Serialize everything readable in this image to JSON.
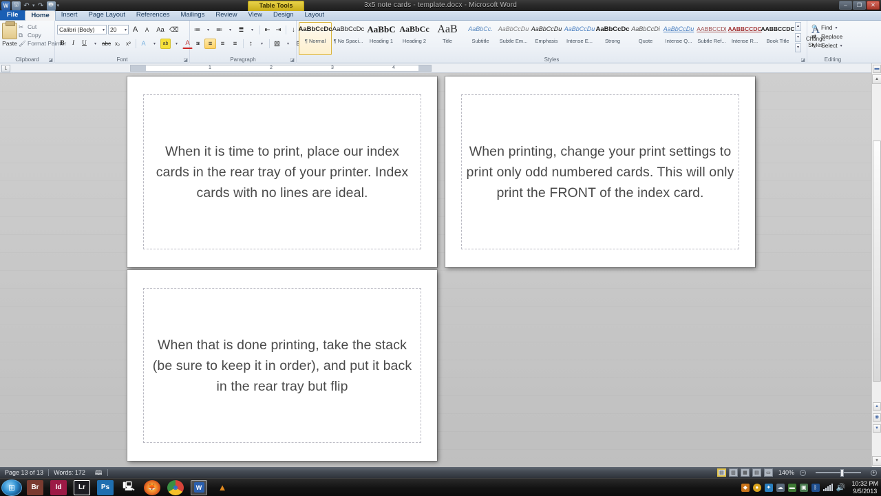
{
  "window": {
    "title": "3x5 note cards - template.docx - Microsoft Word",
    "contextual_tab": "Table Tools",
    "minimize": "–",
    "restore": "❐",
    "close": "✕"
  },
  "quick_access": {
    "app_icon": "word-icon",
    "app_letter": "W",
    "items": [
      {
        "name": "save-icon",
        "glyph": "🖫"
      },
      {
        "name": "undo-icon",
        "glyph": "↶"
      },
      {
        "name": "undo-dropdown-icon",
        "glyph": "▾"
      },
      {
        "name": "redo-icon",
        "glyph": "↷"
      },
      {
        "name": "print-preview-icon",
        "glyph": "🖶"
      },
      {
        "name": "customize-qat-icon",
        "glyph": "▾"
      }
    ]
  },
  "tabs": [
    {
      "label": "File",
      "state": "file"
    },
    {
      "label": "Home",
      "state": "active"
    },
    {
      "label": "Insert",
      "state": "normal"
    },
    {
      "label": "Page Layout",
      "state": "normal"
    },
    {
      "label": "References",
      "state": "normal"
    },
    {
      "label": "Mailings",
      "state": "normal"
    },
    {
      "label": "Review",
      "state": "normal"
    },
    {
      "label": "View",
      "state": "normal"
    },
    {
      "label": "Design",
      "state": "normal"
    },
    {
      "label": "Layout",
      "state": "normal"
    }
  ],
  "ribbon": {
    "clipboard": {
      "group_label": "Clipboard",
      "paste_label": "Paste",
      "cut_label": "Cut",
      "copy_label": "Copy",
      "format_painter_label": "Format Painter"
    },
    "font": {
      "group_label": "Font",
      "font_name": "Calibri (Body)",
      "font_size": "20",
      "grow_font": "A",
      "shrink_font": "A",
      "change_case": "Aa",
      "clear_formatting": "⌫",
      "bold": "B",
      "italic": "I",
      "underline": "U",
      "strikethrough": "abc",
      "subscript": "x₂",
      "superscript": "x²",
      "text_effects": "A",
      "highlight": "ab",
      "font_color": "A"
    },
    "paragraph": {
      "group_label": "Paragraph",
      "bullets": "≔",
      "numbering": "≕",
      "multilevel": "≣",
      "decrease_indent": "⇤",
      "increase_indent": "⇥",
      "sort": "↓",
      "show_marks": "¶",
      "align_left": "≡",
      "align_center": "≡",
      "align_right": "≡",
      "justify": "≡",
      "line_spacing": "↕",
      "shading": "▧",
      "borders": "⊞",
      "active_alignment": "align-center"
    },
    "styles": {
      "group_label": "Styles",
      "items": [
        {
          "preview": "AaBbCcDc",
          "name": "¶ Normal",
          "selected": true
        },
        {
          "preview": "AaBbCcDc",
          "name": "¶ No Spaci...",
          "selected": false
        },
        {
          "preview": "AaBbC",
          "name": "Heading 1",
          "selected": false
        },
        {
          "preview": "AaBbCc",
          "name": "Heading 2",
          "selected": false
        },
        {
          "preview": "AaB",
          "name": "Title",
          "selected": false
        },
        {
          "preview": "AaBbCc.",
          "name": "Subtitle",
          "selected": false
        },
        {
          "preview": "AaBbCcDu",
          "name": "Subtle Em...",
          "selected": false
        },
        {
          "preview": "AaBbCcDu",
          "name": "Emphasis",
          "selected": false
        },
        {
          "preview": "AaBbCcDu",
          "name": "Intense E...",
          "selected": false
        },
        {
          "preview": "AaBbCcDc",
          "name": "Strong",
          "selected": false
        },
        {
          "preview": "AaBbCcDi",
          "name": "Quote",
          "selected": false
        },
        {
          "preview": "AaBbCcDu",
          "name": "Intense Q...",
          "selected": false
        },
        {
          "preview": "AABBCCDI",
          "name": "Subtle Ref...",
          "selected": false
        },
        {
          "preview": "AABBCCDC",
          "name": "Intense R...",
          "selected": false
        },
        {
          "preview": "AABBCCDC",
          "name": "Book Title",
          "selected": false
        }
      ],
      "scroll_up": "▴",
      "scroll_down": "▾",
      "more": "▾",
      "change_styles_label": "Change",
      "change_styles_label2": "Styles"
    },
    "editing": {
      "group_label": "Editing",
      "find_label": "Find",
      "replace_label": "Replace",
      "select_label": "Select"
    }
  },
  "ruler": {
    "corner_marker": "L",
    "numbers": [
      "1",
      "2",
      "3",
      "4"
    ]
  },
  "document": {
    "cards": [
      {
        "id": "card-1",
        "text": "When it is time to print, place our index cards in the rear tray of your printer.  Index cards with no lines are ideal."
      },
      {
        "id": "card-2",
        "text": "When printing, change your print settings to print only odd numbered cards.  This will only print the FRONT of the index card."
      },
      {
        "id": "card-3",
        "text": "When that is done printing, take the stack (be sure to keep it in order), and put it back in the rear tray but flip"
      }
    ]
  },
  "status_bar": {
    "page": "Page 13 of 13",
    "words": "Words: 172",
    "proofing_icon": "proofing-errors-icon",
    "zoom_level": "140%",
    "zoom_out": "−",
    "zoom_in": "+",
    "views": [
      {
        "name": "print-layout-view",
        "glyph": "▤",
        "active": true
      },
      {
        "name": "full-screen-reading-view",
        "glyph": "▥",
        "active": false
      },
      {
        "name": "web-layout-view",
        "glyph": "▦",
        "active": false
      },
      {
        "name": "outline-view",
        "glyph": "▤",
        "active": false
      },
      {
        "name": "draft-view",
        "glyph": "▭",
        "active": false
      }
    ]
  },
  "taskbar": {
    "start_glyph": "⊞",
    "apps": [
      {
        "name": "adobe-bridge-icon",
        "label": "Br",
        "bg": "#7a3b30",
        "active": false
      },
      {
        "name": "adobe-indesign-icon",
        "label": "Id",
        "bg": "#9c1a46",
        "active": false
      },
      {
        "name": "adobe-lightroom-icon",
        "label": "Lr",
        "bg": "#1c1c22",
        "active": false
      },
      {
        "name": "adobe-photoshop-icon",
        "label": "Ps",
        "bg": "#1f6fb0",
        "active": false
      },
      {
        "name": "computer-icon",
        "label": "🖳",
        "bg": "#54657a",
        "active": false
      },
      {
        "name": "firefox-icon",
        "label": "🦊",
        "bg": "#d96a1c",
        "active": false
      },
      {
        "name": "chrome-icon",
        "label": "◉",
        "bg": "#d8443a",
        "active": false
      },
      {
        "name": "word-icon",
        "label": "W",
        "bg": "#2a5fae",
        "active": true
      },
      {
        "name": "vlc-icon",
        "label": "▲",
        "bg": "#cf7a1b",
        "active": false
      }
    ],
    "tray": [
      {
        "name": "tray-orange-icon",
        "glyph": "◆",
        "bg": "#c8741a"
      },
      {
        "name": "tray-yellow-icon",
        "glyph": "●",
        "bg": "#d8a21c"
      },
      {
        "name": "tray-dropbox-icon",
        "glyph": "✦",
        "bg": "#2a7fbe"
      },
      {
        "name": "tray-cloud-icon",
        "glyph": "☁",
        "bg": "#5a6a7a"
      },
      {
        "name": "tray-green-icon",
        "glyph": "▬",
        "bg": "#3f7a35"
      },
      {
        "name": "tray-box-icon",
        "glyph": "▣",
        "bg": "#4a7a50"
      },
      {
        "name": "tray-bluetooth-icon",
        "glyph": "ᛒ",
        "bg": "#1f4f8f"
      }
    ],
    "clock_time": "10:32 PM",
    "clock_date": "9/5/2013"
  }
}
